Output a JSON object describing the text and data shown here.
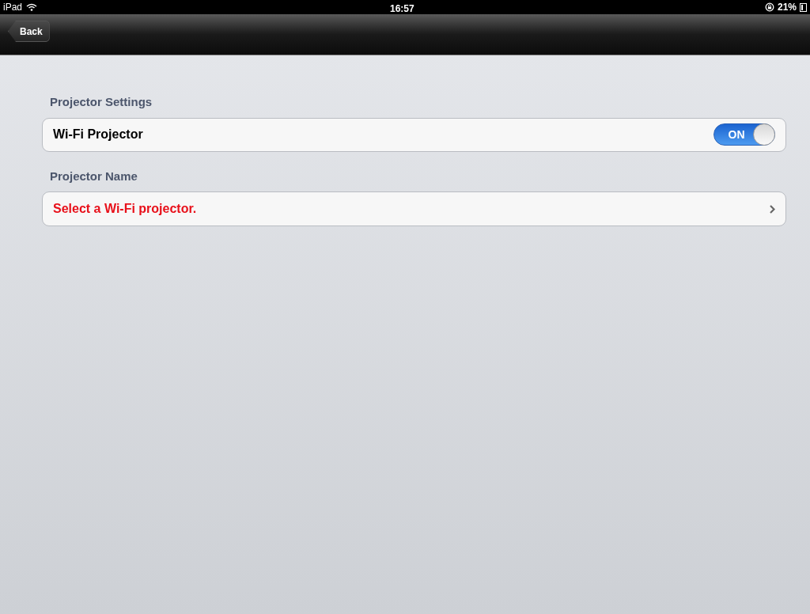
{
  "status_bar": {
    "carrier": "iPad",
    "time": "16:57",
    "battery": "21%"
  },
  "nav_bar": {
    "back_button": "Back"
  },
  "sections": [
    {
      "header": "Projector Settings",
      "row": {
        "kind": "toggle",
        "label": "Wi-Fi Projector",
        "switch_label": "ON",
        "on": true
      }
    },
    {
      "header": "Projector Name",
      "row": {
        "kind": "link",
        "label": "Select a Wi-Fi projector."
      }
    }
  ]
}
